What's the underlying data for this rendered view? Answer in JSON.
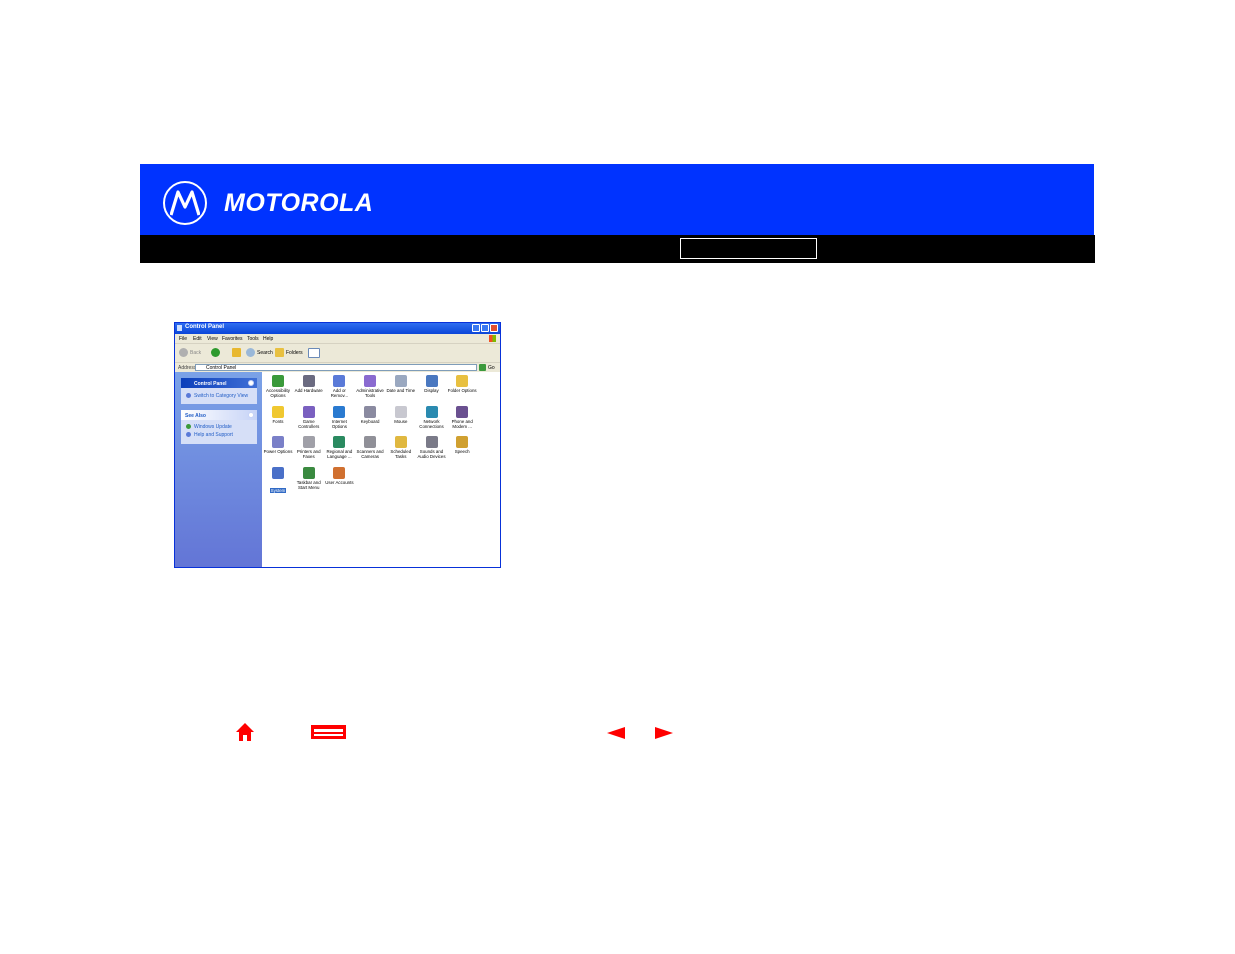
{
  "brand": {
    "name": "MOTOROLA"
  },
  "window": {
    "title": "Control Panel",
    "menu": [
      "File",
      "Edit",
      "View",
      "Favorites",
      "Tools",
      "Help"
    ],
    "toolbar": {
      "back": "Back",
      "search": "Search",
      "folders": "Folders"
    },
    "address": {
      "label": "Address",
      "value": "Control Panel",
      "go": "Go"
    },
    "tasks": {
      "header": "Control Panel",
      "switch_view": "Switch to Category View",
      "see_also": "See Also",
      "links": [
        "Windows Update",
        "Help and Support"
      ]
    },
    "icons": [
      {
        "label": "Accessibility Options",
        "color": "#3a9a3a",
        "selected": false
      },
      {
        "label": "Add Hardware",
        "color": "#6a6a80",
        "selected": false
      },
      {
        "label": "Add or Remov...",
        "color": "#5a7ad8",
        "selected": false
      },
      {
        "label": "Administrative Tools",
        "color": "#8a6ad0",
        "selected": false
      },
      {
        "label": "Date and Time",
        "color": "#9aa8c0",
        "selected": false
      },
      {
        "label": "Display",
        "color": "#4a78c0",
        "selected": false
      },
      {
        "label": "Folder Options",
        "color": "#e8c040",
        "selected": false
      },
      {
        "label": "Fonts",
        "color": "#f0c830",
        "selected": false
      },
      {
        "label": "Game Controllers",
        "color": "#7a60c0",
        "selected": false
      },
      {
        "label": "Internet Options",
        "color": "#2a7ad0",
        "selected": false
      },
      {
        "label": "Keyboard",
        "color": "#8a8aa0",
        "selected": false
      },
      {
        "label": "Mouse",
        "color": "#c8c8d0",
        "selected": false
      },
      {
        "label": "Network Connections",
        "color": "#2a8ab0",
        "selected": false
      },
      {
        "label": "Phone and Modem ...",
        "color": "#6a5090",
        "selected": false
      },
      {
        "label": "Power Options",
        "color": "#7a80c8",
        "selected": false
      },
      {
        "label": "Printers and Faxes",
        "color": "#a0a0a8",
        "selected": false
      },
      {
        "label": "Regional and Language ...",
        "color": "#2a8a60",
        "selected": false
      },
      {
        "label": "Scanners and Cameras",
        "color": "#909098",
        "selected": false
      },
      {
        "label": "Scheduled Tasks",
        "color": "#e0b840",
        "selected": false
      },
      {
        "label": "Sounds and Audio Devices",
        "color": "#7a7a88",
        "selected": false
      },
      {
        "label": "Speech",
        "color": "#d0a030",
        "selected": false
      },
      {
        "label": "System",
        "color": "#4a70c8",
        "selected": true
      },
      {
        "label": "Taskbar and Start Menu",
        "color": "#3a8a40",
        "selected": false
      },
      {
        "label": "User Accounts",
        "color": "#d07030",
        "selected": false
      }
    ]
  },
  "nav": {
    "icons": [
      "home-icon",
      "print-icon",
      "previous-icon",
      "next-icon"
    ],
    "accent": "#ff0000"
  }
}
